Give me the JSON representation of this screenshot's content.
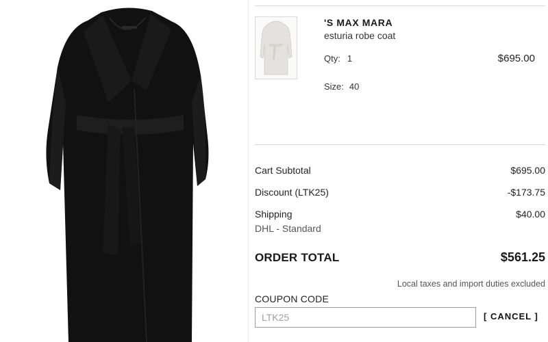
{
  "product": {
    "brand": "'S MAX MARA",
    "name": "esturia robe coat",
    "qty_label": "Qty:",
    "qty_value": "1",
    "price": "$695.00",
    "size_label": "Size:",
    "size_value": "40"
  },
  "summary": {
    "subtotal_label": "Cart Subtotal",
    "subtotal_value": "$695.00",
    "discount_label": "Discount (LTK25)",
    "discount_value": "-$173.75",
    "shipping_label": "Shipping",
    "shipping_method": "DHL - Standard",
    "shipping_value": "$40.00",
    "total_label": "ORDER TOTAL",
    "total_value": "$561.25",
    "tax_note": "Local taxes and import duties excluded"
  },
  "coupon": {
    "label": "COUPON CODE",
    "placeholder": "LTK25",
    "cancel_label": "[ CANCEL ]"
  },
  "colors": {
    "coat_main": "#111111",
    "thumb_coat": "#e4e2de",
    "rule": "#d4d4d4"
  },
  "icons": {
    "product_image": "black-wrap-coat",
    "product_thumbnail": "light-grey-robe-coat"
  }
}
